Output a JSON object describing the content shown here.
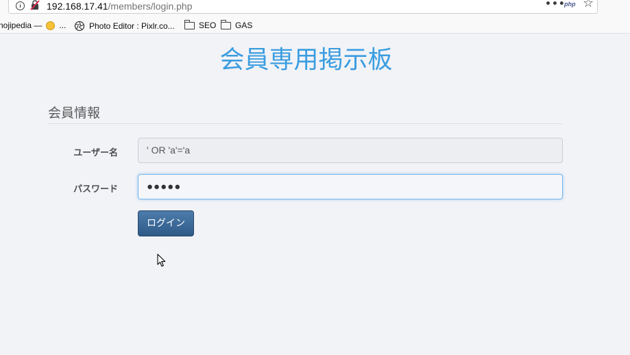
{
  "browser": {
    "url_host": "192.168.17.41",
    "url_path": "/members/login.php",
    "page_action_more": "•••",
    "page_action_php": "php",
    "bookmark_star": "☆",
    "bookmarks": [
      {
        "label": "nojipedia — 🙂 ...",
        "text": "nojipedia —",
        "suffix": "...",
        "icon": "smiley-icon"
      },
      {
        "label": "Photo Editor : Pixlr.co...",
        "icon": "aperture-icon"
      },
      {
        "label": "SEO",
        "icon": "folder-icon"
      },
      {
        "label": "GAS",
        "icon": "folder-icon"
      }
    ]
  },
  "page": {
    "title": "会員専用掲示板",
    "section_title": "会員情報",
    "username_label": "ユーザー名",
    "username_value": "' OR 'a'='a",
    "password_label": "パスワード",
    "password_mask": "●●●●●",
    "login_button": "ログイン"
  },
  "colors": {
    "title": "#3b9de0",
    "button": "#2f5a88",
    "page_bg": "#f2f3f7"
  }
}
